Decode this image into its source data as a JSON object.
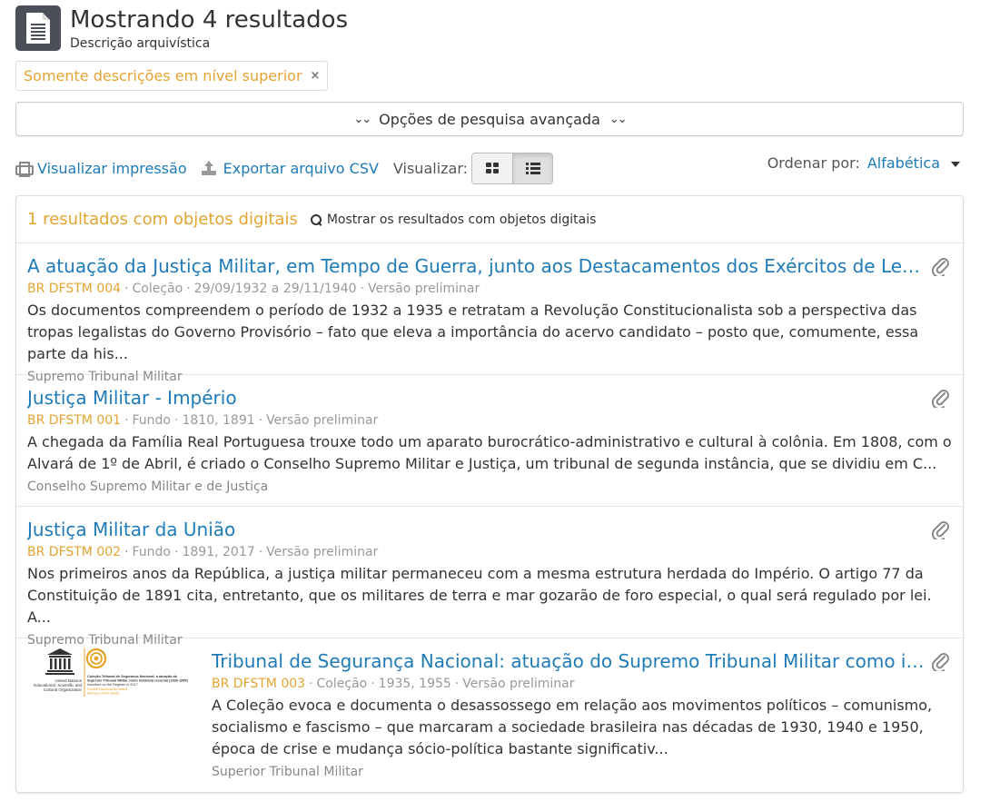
{
  "header": {
    "title": "Mostrando 4 resultados",
    "subtitle": "Descrição arquivística"
  },
  "filter": {
    "label": "Somente descrições em nível superior",
    "remove": "×"
  },
  "advanced": {
    "label": "Opções de pesquisa avançada"
  },
  "toolbar": {
    "print": "Visualizar impressão",
    "export": "Exportar arquivo CSV",
    "view_label": "Visualizar:"
  },
  "sort": {
    "label": "Ordenar por:",
    "value": "Alfabética"
  },
  "results_head": {
    "count": "1 resultados com objetos digitais",
    "show": "Mostrar os resultados com objetos digitais"
  },
  "items": [
    {
      "title": "A atuação da Justiça Militar, em Tempo de Guerra, junto aos Destacamentos dos Exércitos de Leste e de Sul...",
      "ref": "BR DFSTM 004",
      "level": "Coleção",
      "dates": "29/09/1932 a 29/11/1940",
      "status": "Versão preliminar",
      "description": "Os documentos compreendem o período de 1932 a 1935 e retratam a Revolução Constitucionalista sob a perspectiva das tropas legalistas do Governo Provisório – fato que eleva a importância do acervo candidato – posto que, comumente, essa parte da his...",
      "repository": "Supremo Tribunal Militar"
    },
    {
      "title": "Justiça Militar - Império",
      "ref": "BR DFSTM 001",
      "level": "Fundo",
      "dates": "1810, 1891",
      "status": "Versão preliminar",
      "description": "A chegada da Família Real Portuguesa trouxe todo um aparato burocrático-administrativo e cultural à colônia. Em 1808, com o Alvará de 1º de Abril, é criado o Conselho Supremo Militar e Justiça, um tribunal de segunda instância, que se dividiu em C...",
      "repository": "Conselho Supremo Militar e de Justiça"
    },
    {
      "title": "Justiça Militar da União",
      "ref": "BR DFSTM 002",
      "level": "Fundo",
      "dates": "1891, 2017",
      "status": "Versão preliminar",
      "description": "Nos primeiros anos da República, a justiça militar permaneceu com a mesma estrutura herdada do Império. O artigo 77 da Constituição de 1891 cita, entretanto, que os militares de terra e mar gozarão de foro especial, o qual será regulado por lei. A...",
      "repository": "Supremo Tribunal Militar"
    },
    {
      "title": "Tribunal de Segurança Nacional: atuação do Supremo Tribunal Militar como instância...",
      "ref": "BR DFSTM 003",
      "level": "Coleção",
      "dates": "1935, 1955",
      "status": "Versão preliminar",
      "description": "A Coleção evoca e documenta o desassossego em relação aos movimentos políticos – comunismo, socialismo e fascismo – que marcaram a sociedade brasileira nas décadas de 1930, 1940 e 1950, época de crise e mudança sócio-política bastante significativ...",
      "repository": "Superior Tribunal Militar",
      "thumbnail": {
        "org_lines": [
          "United Nations",
          "Educational, Scientific and",
          "Cultural Organization"
        ],
        "text_lines": [
          "Coleção Tribunal de Segurança Nacional: a atuação do",
          "Supremo Tribunal Militar como instância recursal (1936-1955)",
          "Inscribed on the Register in 2017"
        ],
        "mow_lines": [
          "Comitê Nacional do Brasil",
          "Memory of the World"
        ]
      }
    }
  ],
  "colors": {
    "link": "#1e7bb8",
    "accent": "#e4a431",
    "muted": "#999999"
  }
}
